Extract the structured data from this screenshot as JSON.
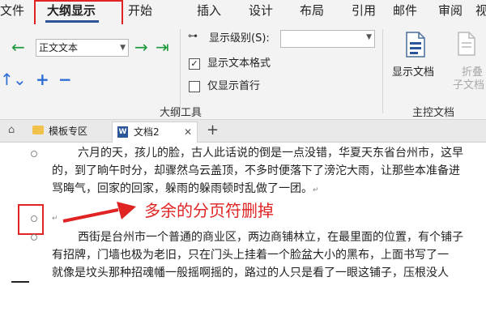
{
  "ribbon_tabs": [
    {
      "label": "文件"
    },
    {
      "label": "大纲显示"
    },
    {
      "label": "开始"
    },
    {
      "label": "插入"
    },
    {
      "label": "设计"
    },
    {
      "label": "布局"
    },
    {
      "label": "引用"
    },
    {
      "label": "邮件"
    },
    {
      "label": "审阅"
    },
    {
      "label": "视"
    }
  ],
  "outline_tools": {
    "level_select_value": "正文文本",
    "show_level_label": "显示级别(S):",
    "show_level_value": "",
    "show_text_format_label": "显示文本格式",
    "show_text_format_checked": "✓",
    "first_line_only_label": "仅显示首行",
    "group_label": "大纲工具"
  },
  "master_document": {
    "show_document_label": "显示文档",
    "collapse_label_line1": "折叠",
    "collapse_label_line2": "子文档",
    "group_label": "主控文档"
  },
  "doc_tabs": [
    {
      "label": "模板专区"
    },
    {
      "label": "文档2"
    }
  ],
  "document": {
    "para1_lines": [
      "六月的天，孩儿的脸，古人此话说的倒是一点没错，华夏天东省台州市，这早",
      "的，到了晌午时分，却骤然乌云盖顶，不多时便落下了滂沱大雨，让那些本准备进",
      "骂晦气，回家的回家，躲雨的躲雨顿时乱做了一团。"
    ],
    "para2_lines": [
      "西街是台州市一个普通的商业区，两边商铺林立，在最里面的位置，有个铺子",
      "有招牌，门墙也极为老旧，只在门头上挂着一个脸盆大小的黑布，上面书写了一",
      "就像是坟头那种招魂幡一般摇啊摇的，路过的人只是看了一眼这铺子，压根没人"
    ],
    "annotation": "多余的分页符删掉"
  },
  "colors": {
    "ribbon_bg": "#f3f3f3",
    "accent": "#2b579a",
    "highlight_red": "#e02424",
    "green_arrow": "#1e9a3c",
    "blue_arrow": "#2b6cd4"
  }
}
